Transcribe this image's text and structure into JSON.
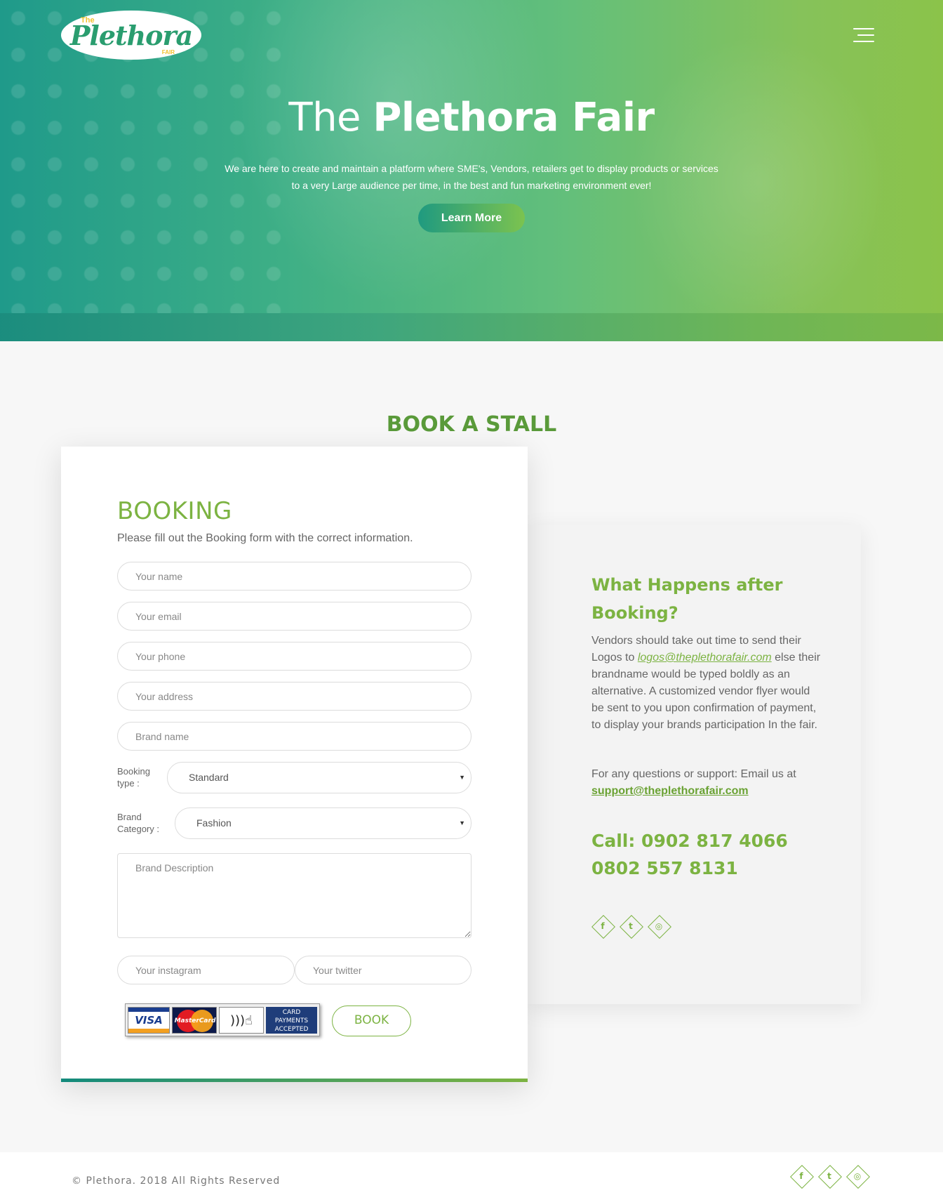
{
  "brand": {
    "logo_text": "Plethora",
    "logo_the": "The",
    "logo_fair": "FAIR"
  },
  "hero": {
    "title_light": "The",
    "title_bold": "Plethora Fair",
    "subtitle": "We are here to create and maintain a platform where SME's, Vendors, retailers get to display products or services to a very Large audience per time, in the best and fun marketing environment ever!",
    "cta_label": "Learn More"
  },
  "section": {
    "title": "BOOK A STALL"
  },
  "form": {
    "title": "BOOKING",
    "description": "Please fill out the Booking form with the correct information.",
    "name_placeholder": "Your name",
    "email_placeholder": "Your email",
    "phone_placeholder": "Your phone",
    "address_placeholder": "Your address",
    "brand_placeholder": "Brand name",
    "booking_type_label_1": "Booking",
    "booking_type_label_2": "type :",
    "booking_type_value": "Standard",
    "brand_category_label_1": "Brand",
    "brand_category_label_2": "Category :",
    "brand_category_value": "Fashion",
    "description_placeholder": "Brand Description",
    "instagram_placeholder": "Your instagram",
    "twitter_placeholder": "Your twitter",
    "payment_badge_text": "CARD PAYMENTS ACCEPTED",
    "payment_visa": "VISA",
    "payment_mastercard": "MasterCard",
    "book_label": "BOOK"
  },
  "info": {
    "heading": "What Happens after Booking?",
    "body_pre": "Vendors should take out time to send their Logos to",
    "logo_email": "logos@theplethorafair.com",
    "body_post": "else their brandname would be typed boldly as an alternative. A customized vendor flyer would be sent to you upon confirmation of payment, to display your brands participation In the fair.",
    "support_text": "For any questions or support: Email us at",
    "support_email": "support@theplethorafair.com",
    "call_line_1": "Call: 0902 817 4066",
    "call_line_2": "0802 557 8131"
  },
  "social": {
    "icons": [
      "facebook-icon",
      "twitter-icon",
      "instagram-icon"
    ],
    "facebook_glyph": "f",
    "twitter_glyph": "t",
    "instagram_glyph": "◎"
  },
  "footer": {
    "copyright": "© Plethora. 2018 All Rights Reserved"
  },
  "colors": {
    "accent": "#7cb342",
    "teal": "#1f9a8a",
    "section_title": "#5a9a3a"
  }
}
